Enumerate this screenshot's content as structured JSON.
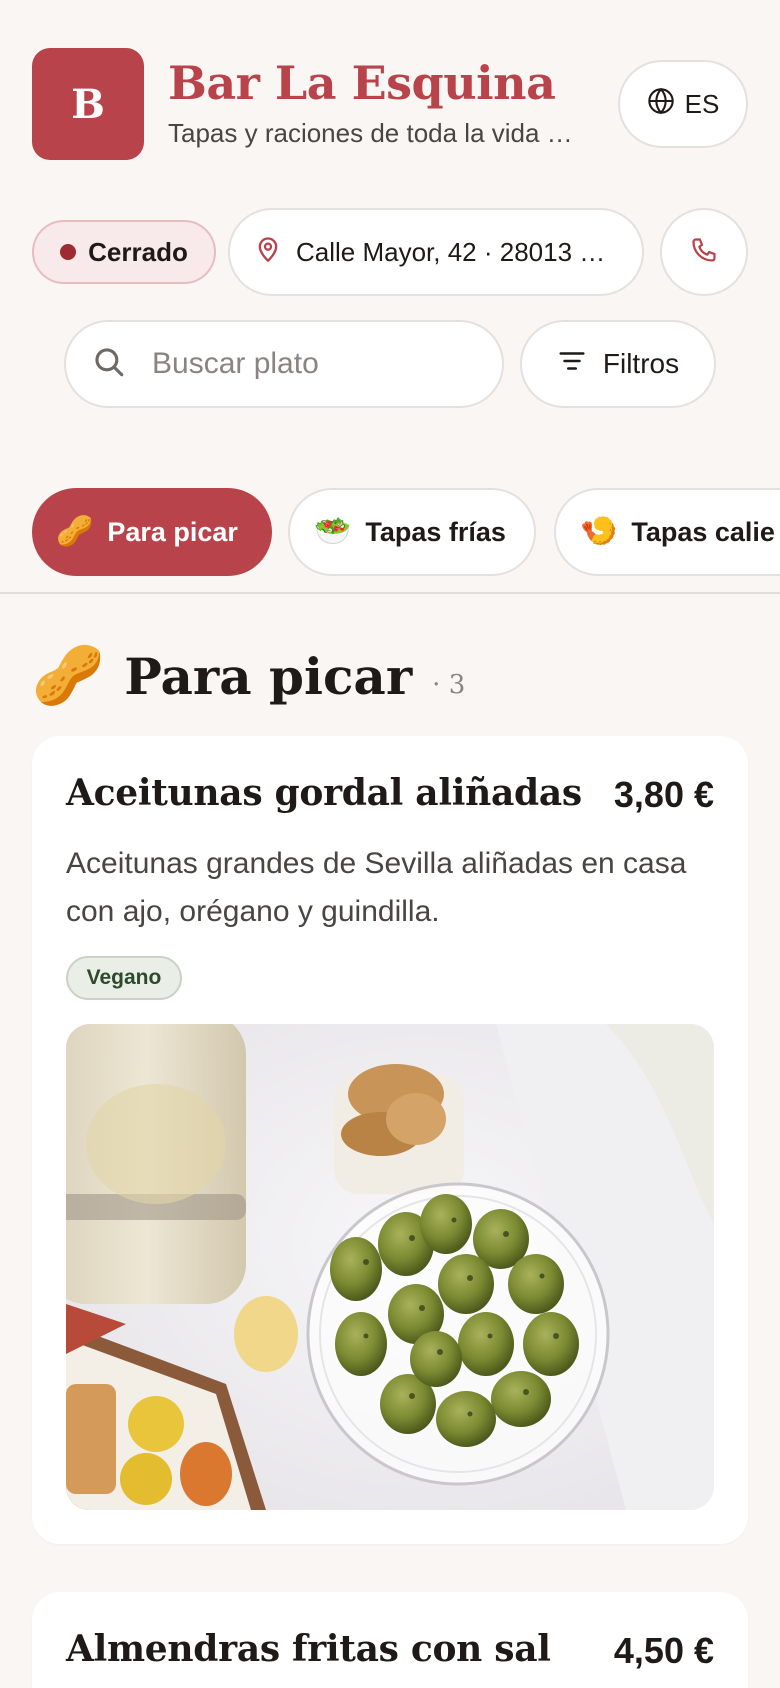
{
  "restaurant": {
    "logo_letter": "B",
    "name": "Bar La Esquina",
    "tagline": "Tapas y raciones de toda la vida …",
    "language": "ES"
  },
  "info": {
    "status": "Cerrado",
    "address": "Calle Mayor, 42 · 28013 …"
  },
  "search": {
    "placeholder": "Buscar plato",
    "filters_label": "Filtros"
  },
  "categories": [
    {
      "emoji": "🥜",
      "label": "Para picar",
      "active": true
    },
    {
      "emoji": "🥗",
      "label": "Tapas frías",
      "active": false
    },
    {
      "emoji": "🍤",
      "label": "Tapas calie",
      "active": false
    }
  ],
  "section": {
    "emoji": "🥜",
    "title": "Para picar",
    "count": "· 3"
  },
  "dishes": [
    {
      "name": "Aceitunas gordal aliñadas",
      "price": "3,80 €",
      "description": "Aceitunas grandes de Sevilla aliñadas en casa con ajo, orégano y guindilla.",
      "tag": "Vegano"
    },
    {
      "name": "Almendras fritas con sal",
      "price": "4,50 €"
    }
  ],
  "colors": {
    "accent": "#b9434b",
    "background": "#f9f6f3",
    "status_dot": "#9e2a32",
    "vegan_tag_bg": "#e9eee6"
  },
  "icons": {
    "language": "globe-icon",
    "address": "map-pin-icon",
    "phone": "phone-icon",
    "search": "search-icon",
    "filters": "filter-lines-icon"
  }
}
